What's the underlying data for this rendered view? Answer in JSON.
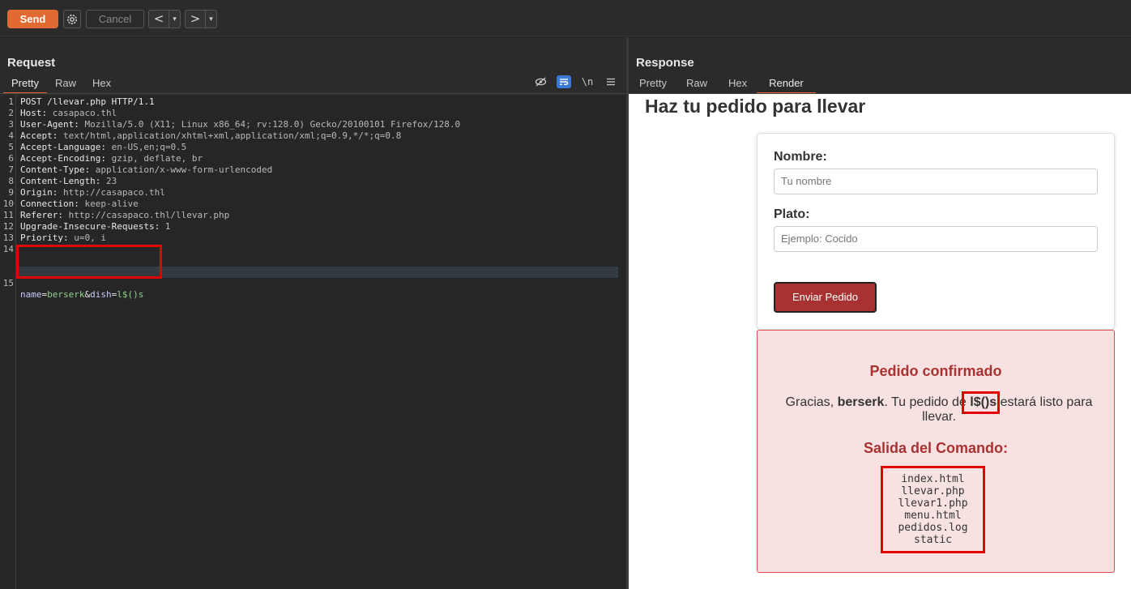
{
  "toolbar": {
    "send_label": "Send",
    "cancel_label": "Cancel",
    "back_label": "<",
    "forward_label": ">",
    "dropdown_glyph": "▾"
  },
  "request": {
    "title": "Request",
    "tabs": [
      "Pretty",
      "Raw",
      "Hex"
    ],
    "active_tab": "Pretty",
    "tools": [
      "hide-whitespace-icon",
      "wrap-lines-icon",
      "newline-icon",
      "menu-icon"
    ],
    "newline_glyph": "\\n",
    "lines": [
      {
        "n": "1",
        "key": "POST /llevar.php HTTP/1.1",
        "val": ""
      },
      {
        "n": "2",
        "key": "Host:",
        "val": " casapaco.thl"
      },
      {
        "n": "3",
        "key": "User-Agent:",
        "val": " Mozilla/5.0 (X11; Linux x86_64; rv:128.0) Gecko/20100101 Firefox/128.0"
      },
      {
        "n": "4",
        "key": "Accept:",
        "val": " text/html,application/xhtml+xml,application/xml;q=0.9,*/*;q=0.8"
      },
      {
        "n": "5",
        "key": "Accept-Language:",
        "val": " en-US,en;q=0.5"
      },
      {
        "n": "6",
        "key": "Accept-Encoding:",
        "val": " gzip, deflate, br"
      },
      {
        "n": "7",
        "key": "Content-Type:",
        "val": " application/x-www-form-urlencoded"
      },
      {
        "n": "8",
        "key": "Content-Length:",
        "val": " 23"
      },
      {
        "n": "9",
        "key": "Origin:",
        "val": " http://casapaco.thl"
      },
      {
        "n": "10",
        "key": "Connection:",
        "val": " keep-alive"
      },
      {
        "n": "11",
        "key": "Referer:",
        "val": " http://casapaco.thl/llevar.php"
      },
      {
        "n": "12",
        "key": "Upgrade-Insecure-Requests:",
        "val": " 1"
      },
      {
        "n": "13",
        "key": "Priority:",
        "val": " u=0, i"
      },
      {
        "n": "14",
        "key": "",
        "val": ""
      }
    ],
    "body_line": {
      "n": "15",
      "p1_key": "name",
      "p1_val": "berserk",
      "sep": "&",
      "p2_key": "dish",
      "p2_val": "l$()s",
      "eq": "="
    }
  },
  "response": {
    "title": "Response",
    "tabs": [
      "Pretty",
      "Raw",
      "Hex",
      "Render"
    ],
    "active_tab": "Render",
    "page": {
      "heading": "Haz tu pedido para llevar",
      "name_label": "Nombre:",
      "name_placeholder": "Tu nombre",
      "dish_label": "Plato:",
      "dish_placeholder": "Ejemplo: Cocido",
      "submit_label": "Enviar Pedido",
      "confirm_title": "Pedido confirmado",
      "thanks_prefix": "Gracias, ",
      "thanks_name": "berserk",
      "thanks_mid": ". Tu pedido de ",
      "thanks_dish": "l$()s",
      "thanks_suffix": " estará listo para llevar.",
      "output_title": "Salida del Comando:",
      "output_files": [
        "index.html",
        "llevar.php",
        "llevar1.php",
        "menu.html",
        "pedidos.log",
        "static"
      ]
    }
  },
  "colors": {
    "accent": "#e06a32",
    "highlight_box": "#e00000",
    "result_bg": "#f8e1e1",
    "result_title": "#a83232"
  }
}
